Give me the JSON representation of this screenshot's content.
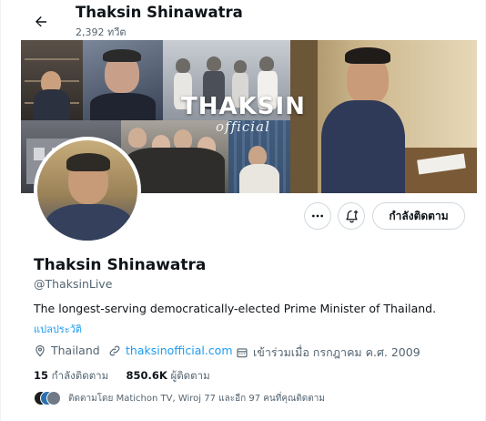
{
  "header": {
    "back_icon": "arrow-left-icon",
    "name": "Thaksin Shinawatra",
    "tweet_count": "2,392 ทวีต"
  },
  "banner": {
    "title": "THAKSIN",
    "subtitle": "official"
  },
  "actions": {
    "more_icon": "more-horizontal-icon",
    "notify_icon": "bell-plus-icon",
    "follow_label": "กำลังติดตาม"
  },
  "profile": {
    "display_name": "Thaksin Shinawatra",
    "handle": "@ThaksinLive",
    "bio": "The longest-serving democratically-elected Prime Minister of Thailand.",
    "translate_label": "แปลประวัติ",
    "location": "Thailand",
    "website": "thaksinofficial.com",
    "joined": "เข้าร่วมเมื่อ กรกฎาคม ค.ศ. 2009",
    "following_count": "15",
    "following_label": "กำลังติดตาม",
    "followers_count": "850.6K",
    "followers_label": "ผู้ติดตาม",
    "followed_by": "ติดตามโดย Matichon TV, Wiroj 77 และอีก 97 คนที่คุณติดตาม"
  },
  "colors": {
    "accent": "#1d9bf0",
    "secondary_text": "#536471",
    "primary_text": "#0f1419"
  }
}
